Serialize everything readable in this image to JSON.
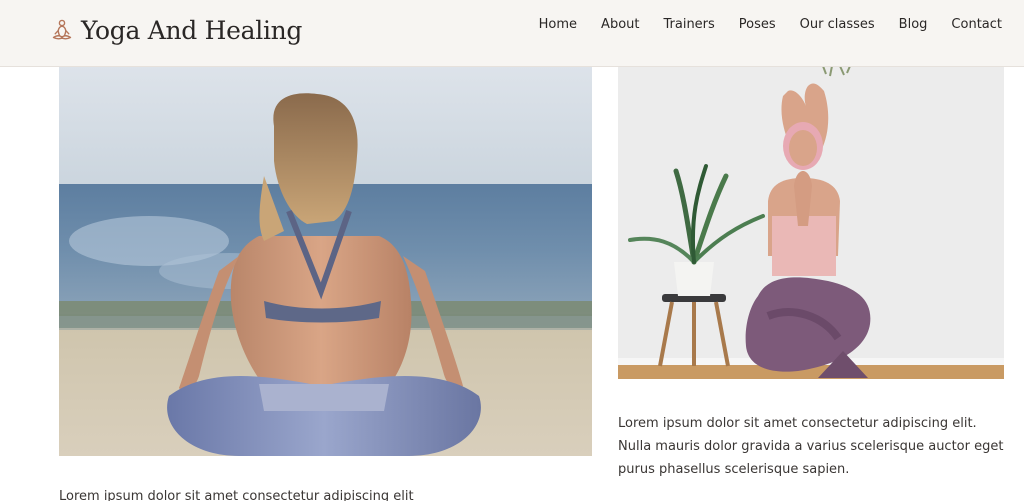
{
  "header": {
    "brand_name": "Yoga And Healing",
    "brand_icon": "meditation-icon",
    "accent_color": "#b5765a"
  },
  "nav": {
    "items": [
      {
        "label": "Home"
      },
      {
        "label": "About"
      },
      {
        "label": "Trainers"
      },
      {
        "label": "Poses"
      },
      {
        "label": "Our classes"
      },
      {
        "label": "Blog"
      },
      {
        "label": "Contact"
      }
    ]
  },
  "gallery": {
    "left": {
      "image": "woman-meditating-by-sea-photo",
      "caption": "Lorem ipsum dolor sit amet consectetur adipiscing elit"
    },
    "right": {
      "image": "woman-eagle-pose-with-plant-photo",
      "caption": "Lorem ipsum dolor sit amet consectetur adipiscing elit. Nulla mauris dolor gravida a varius scelerisque auctor eget purus phasellus scelerisque sapien."
    }
  }
}
